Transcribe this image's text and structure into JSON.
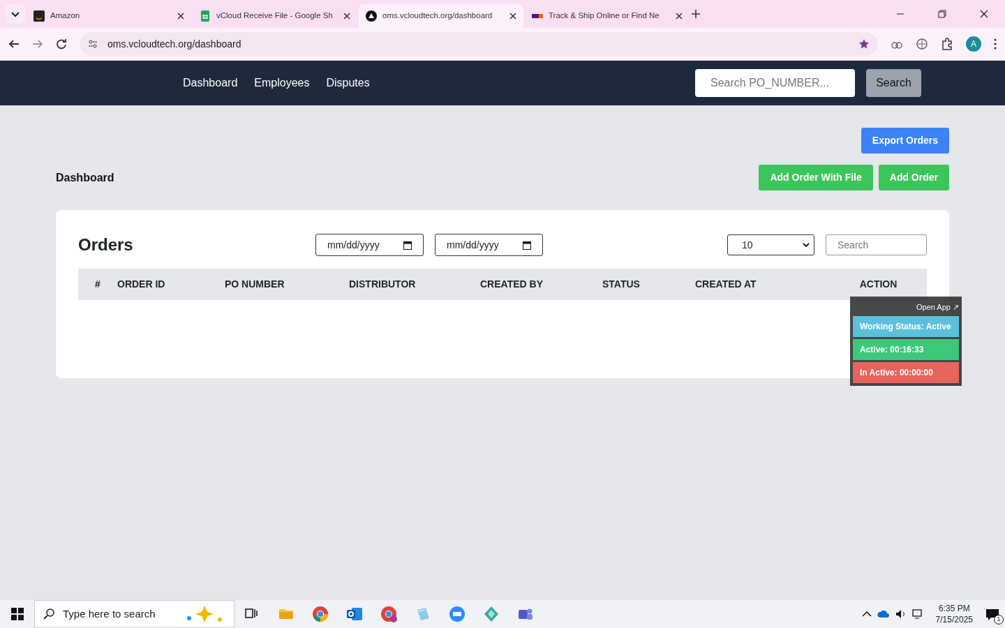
{
  "browser": {
    "tabs": [
      {
        "title": "Amazon",
        "selected": false
      },
      {
        "title": "vCloud Receive File - Google Sh",
        "selected": false
      },
      {
        "title": "oms.vcloudtech.org/dashboard",
        "selected": true
      },
      {
        "title": "Track & Ship Online or Find Ne",
        "selected": false
      }
    ],
    "url": "oms.vcloudtech.org/dashboard",
    "profile": "A"
  },
  "navbar": {
    "links": [
      "Dashboard",
      "Employees",
      "Disputes"
    ],
    "search_placeholder": "Search PO_NUMBER...",
    "search_button": "Search"
  },
  "page": {
    "title": "Dashboard",
    "export_button": "Export Orders",
    "buttons": [
      "Add Order With File",
      "Add Order"
    ]
  },
  "orders": {
    "title": "Orders",
    "date_fields": [
      "mm/dd/yyyy",
      "mm/dd/yyyy"
    ],
    "page_size": "10",
    "search_placeholder": "Search",
    "columns": [
      "#",
      "ORDER ID",
      "PO NUMBER",
      "DISTRIBUTOR",
      "CREATED BY",
      "STATUS",
      "CREATED AT",
      "ACTION"
    ]
  },
  "tracker": {
    "open_app": "Open App ↗",
    "rows": [
      {
        "text": "Working Status: Active",
        "color": "#5bc0de"
      },
      {
        "text": "Active: 00:16:33",
        "color": "#3cc878"
      },
      {
        "text": "In Active: 00:00:00",
        "color": "#e8645c"
      }
    ]
  },
  "taskbar": {
    "search_placeholder": "Type here to search",
    "time": "6:35 PM",
    "date": "7/15/2025",
    "notifications": "1"
  }
}
